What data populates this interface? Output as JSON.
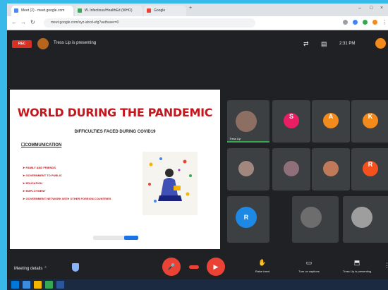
{
  "browser": {
    "tabs": [
      {
        "title": "Meet (2) - meet.google.com"
      },
      {
        "title": "W. Infectious/HealthEd (WHO)"
      },
      {
        "title": "Google"
      }
    ],
    "url": "meet.google.com/xyz-abcd-efg?authuser=0"
  },
  "meet": {
    "recording_label": "REC",
    "presenting_text": "Tress Lip is presenting",
    "time": "2:31 PM",
    "colors": {
      "accent": "#1a73e8",
      "danger": "#ea4335",
      "bg": "#202124"
    }
  },
  "slide": {
    "title": "WORLD DURING THE PANDEMIC",
    "subtitle": "DIFFICULTIES FACED DURING COVID19",
    "heading": "COMMUNICATION",
    "bullets": [
      "FAMILY AND FRIENDS",
      "GOVERNMENT TO PUBLIC",
      "EDUCATION",
      "EMPLOYMENT",
      "GOVERNMENT NETWORK WITH OTHER FOREIGN COUNTRIES"
    ]
  },
  "participants": [
    {
      "name": "Tress Lip",
      "color": "#8d6e63",
      "letter": ""
    },
    {
      "name": "",
      "color": "#e91e63",
      "letter": "S"
    },
    {
      "name": "",
      "color": "#f28b1c",
      "letter": "A"
    },
    {
      "name": "",
      "color": "#f28b1c",
      "letter": "K"
    },
    {
      "name": "",
      "color": "#a1887f",
      "letter": ""
    },
    {
      "name": "",
      "color": "#8e6f7a",
      "letter": ""
    },
    {
      "name": "",
      "color": "#c07a5a",
      "letter": ""
    },
    {
      "name": "",
      "color": "#f4511e",
      "letter": "R"
    },
    {
      "name": "",
      "color": "#1e88e5",
      "letter": "R"
    },
    {
      "name": "",
      "color": "#6d6d6d",
      "letter": ""
    },
    {
      "name": "",
      "color": "#9e9e9e",
      "letter": ""
    }
  ],
  "controls": {
    "meeting_details": "Meeting details",
    "raise_hand": "Raise hand",
    "turn_on_captions": "Turn on captions",
    "present": "Tress Lip is presenting"
  }
}
